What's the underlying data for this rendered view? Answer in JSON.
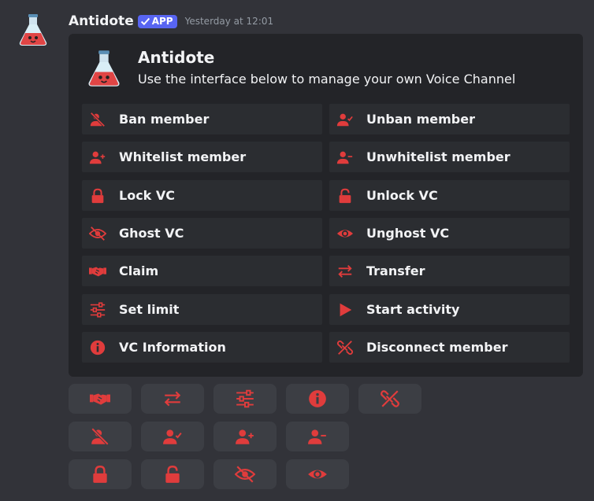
{
  "message": {
    "author": "Antidote",
    "badge": "APP",
    "timestamp": "Yesterday at 12:01"
  },
  "embed": {
    "title": "Antidote",
    "description": "Use the interface below to manage your own Voice Channel",
    "items": [
      {
        "label": "Ban member",
        "icon": "user-ban-icon"
      },
      {
        "label": "Unban member",
        "icon": "user-check-icon"
      },
      {
        "label": "Whitelist member",
        "icon": "user-plus-icon"
      },
      {
        "label": "Unwhitelist member",
        "icon": "user-minus-icon"
      },
      {
        "label": "Lock VC",
        "icon": "lock-icon"
      },
      {
        "label": "Unlock VC",
        "icon": "unlock-icon"
      },
      {
        "label": "Ghost VC",
        "icon": "eye-off-icon"
      },
      {
        "label": "Unghost VC",
        "icon": "eye-icon"
      },
      {
        "label": "Claim",
        "icon": "handshake-icon"
      },
      {
        "label": "Transfer",
        "icon": "arrows-swap-icon"
      },
      {
        "label": "Set limit",
        "icon": "sliders-icon"
      },
      {
        "label": "Start activity",
        "icon": "play-icon"
      },
      {
        "label": "VC Information",
        "icon": "info-icon"
      },
      {
        "label": "Disconnect member",
        "icon": "link-broken-icon"
      }
    ]
  },
  "buttons": [
    [
      "handshake-icon",
      "arrows-swap-icon",
      "sliders-icon",
      "info-icon",
      "link-broken-icon"
    ],
    [
      "user-ban-icon",
      "user-check-icon",
      "user-plus-icon",
      "user-minus-icon"
    ],
    [
      "lock-icon",
      "unlock-icon",
      "eye-off-icon",
      "eye-icon"
    ]
  ],
  "colors": {
    "accent": "#e03c3c",
    "background": "#323339",
    "embed": "#232428",
    "cell": "#2b2d31",
    "button": "#3c3e44",
    "badge": "#5865f2"
  }
}
